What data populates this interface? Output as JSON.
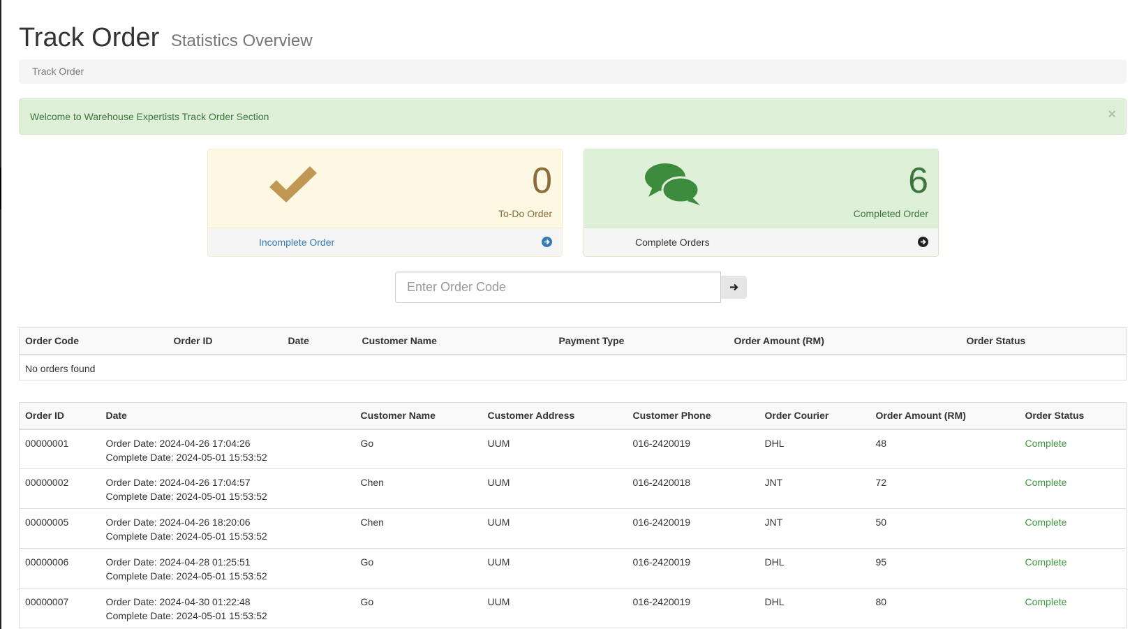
{
  "header": {
    "title": "Track Order",
    "subtitle": "Statistics Overview"
  },
  "breadcrumb": {
    "label": "Track Order"
  },
  "alert": {
    "message": "Welcome to Warehouse Expertists Track Order Section",
    "close": "×"
  },
  "panels": {
    "todo": {
      "count": "0",
      "caption": "To-Do Order",
      "link": "Incomplete Order",
      "icon": "check-icon",
      "color": "#8a6d3b"
    },
    "completed": {
      "count": "6",
      "caption": "Completed Order",
      "link": "Complete Orders",
      "icon": "comments-icon",
      "color": "#3c763d"
    }
  },
  "search": {
    "placeholder": "Enter Order Code",
    "value": ""
  },
  "pending_table": {
    "headers": [
      "Order Code",
      "Order ID",
      "Date",
      "Customer Name",
      "Payment Type",
      "Order Amount (RM)",
      "Order Status"
    ],
    "empty_message": "No orders found"
  },
  "orders_table": {
    "headers": [
      "Order ID",
      "Date",
      "Customer Name",
      "Customer Address",
      "Customer Phone",
      "Order Courier",
      "Order Amount (RM)",
      "Order Status"
    ],
    "rows": [
      {
        "id": "00000001",
        "order_date": "Order Date: 2024-04-26 17:04:26",
        "complete_date": "Complete Date: 2024-05-01 15:53:52",
        "name": "Go",
        "address": "UUM",
        "phone": "016-2420019",
        "courier": "DHL",
        "amount": "48",
        "status": "Complete"
      },
      {
        "id": "00000002",
        "order_date": "Order Date: 2024-04-26 17:04:57",
        "complete_date": "Complete Date: 2024-05-01 15:53:52",
        "name": "Chen",
        "address": "UUM",
        "phone": "016-2420018",
        "courier": "JNT",
        "amount": "72",
        "status": "Complete"
      },
      {
        "id": "00000005",
        "order_date": "Order Date: 2024-04-26 18:20:06",
        "complete_date": "Complete Date: 2024-05-01 15:53:52",
        "name": "Chen",
        "address": "UUM",
        "phone": "016-2420019",
        "courier": "JNT",
        "amount": "50",
        "status": "Complete"
      },
      {
        "id": "00000006",
        "order_date": "Order Date: 2024-04-28 01:25:51",
        "complete_date": "Complete Date: 2024-05-01 15:53:52",
        "name": "Go",
        "address": "UUM",
        "phone": "016-2420019",
        "courier": "DHL",
        "amount": "95",
        "status": "Complete"
      },
      {
        "id": "00000007",
        "order_date": "Order Date: 2024-04-30 01:22:48",
        "complete_date": "Complete Date: 2024-05-01 15:53:52",
        "name": "Go",
        "address": "UUM",
        "phone": "016-2420019",
        "courier": "DHL",
        "amount": "80",
        "status": "Complete"
      }
    ]
  },
  "colors": {
    "success_text": "#3c763d",
    "status_complete": "#3c9a3c",
    "link": "#337ab7"
  }
}
